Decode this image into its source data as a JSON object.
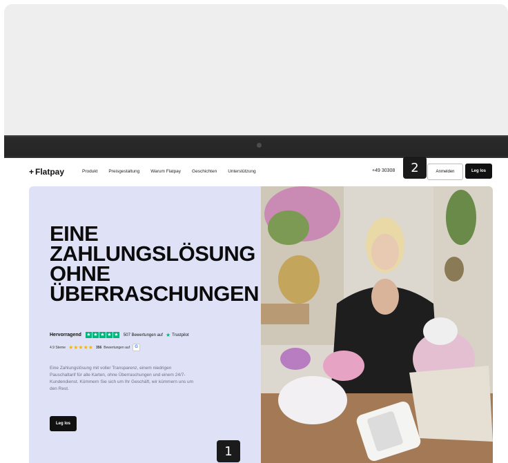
{
  "site": {
    "logo": "Flatpay",
    "nav": [
      "Produkt",
      "Preisgestaltung",
      "Warum Flatpay",
      "Geschichten",
      "Unterstützung"
    ],
    "phone": "+49 30308",
    "login_label": "Anmelden",
    "cta_label": "Leg los"
  },
  "hero": {
    "headline": [
      "EINE",
      "ZAHLUNGSLÖSUNG",
      "OHNE",
      "ÜBERRASCHUNGEN"
    ],
    "trustpilot": {
      "label": "Hervorragend",
      "reviews": "507 Bewertungen auf",
      "brand": "Trustpilot"
    },
    "google": {
      "label": "4.9 Sterne",
      "reviews_count": "356",
      "reviews_text": "Bewertungen auf"
    },
    "description": "Eine Zahlungslösung mit voller Transparenz, einem niedrigen Pauschaltarif für alle Karten, ohne Überraschungen und einem 24/7-Kundendienst. Kümmern Sie sich um Ihr Geschäft, wir kümmern uns um den Rest.",
    "cta_label": "Leg los"
  },
  "markers": [
    "1",
    "2"
  ],
  "colors": {
    "hero_bg": "#dfe2f6",
    "trustpilot_green": "#00b67a",
    "star_gold": "#f4b400",
    "button_dark": "#111111"
  },
  "icons": {
    "logo_mark": "plus-sparkle-icon",
    "star": "star-icon",
    "google": "google-icon"
  }
}
